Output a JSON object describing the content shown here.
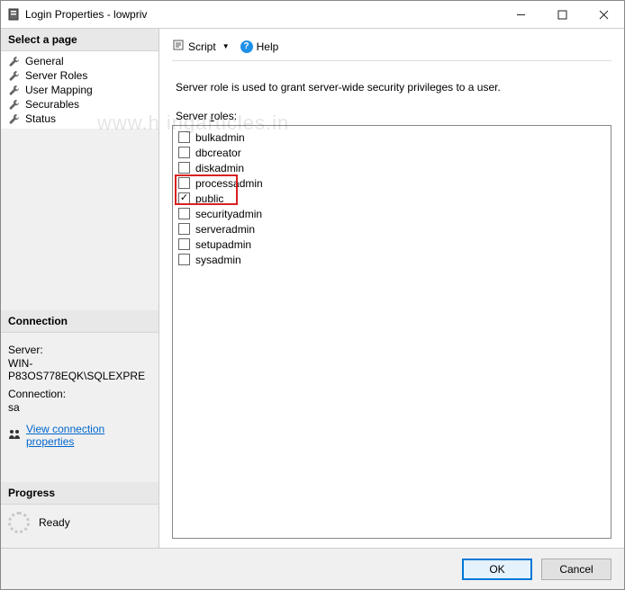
{
  "window": {
    "title": "Login Properties - lowpriv"
  },
  "sidebar": {
    "select_page_header": "Select a page",
    "pages": [
      {
        "label": "General"
      },
      {
        "label": "Server Roles"
      },
      {
        "label": "User Mapping"
      },
      {
        "label": "Securables"
      },
      {
        "label": "Status"
      }
    ],
    "connection_header": "Connection",
    "server_label": "Server:",
    "server_value": "WIN-P83OS778EQK\\SQLEXPRE",
    "connection_label": "Connection:",
    "connection_value": "sa",
    "view_connection_link": "View connection properties",
    "progress_header": "Progress",
    "progress_status": "Ready"
  },
  "toolbar": {
    "script_label": "Script",
    "help_label": "Help"
  },
  "main": {
    "description": "Server role is used to grant server-wide security privileges to a user.",
    "roles_prefix": "Server ",
    "roles_underline": "r",
    "roles_suffix": "oles:",
    "roles": [
      {
        "name": "bulkadmin",
        "checked": false
      },
      {
        "name": "dbcreator",
        "checked": false
      },
      {
        "name": "diskadmin",
        "checked": false
      },
      {
        "name": "processadmin",
        "checked": false
      },
      {
        "name": "public",
        "checked": true
      },
      {
        "name": "securityadmin",
        "checked": false
      },
      {
        "name": "serveradmin",
        "checked": false
      },
      {
        "name": "setupadmin",
        "checked": false
      },
      {
        "name": "sysadmin",
        "checked": false
      }
    ]
  },
  "footer": {
    "ok": "OK",
    "cancel": "Cancel"
  },
  "watermark": "www.h     ingarticles.in"
}
